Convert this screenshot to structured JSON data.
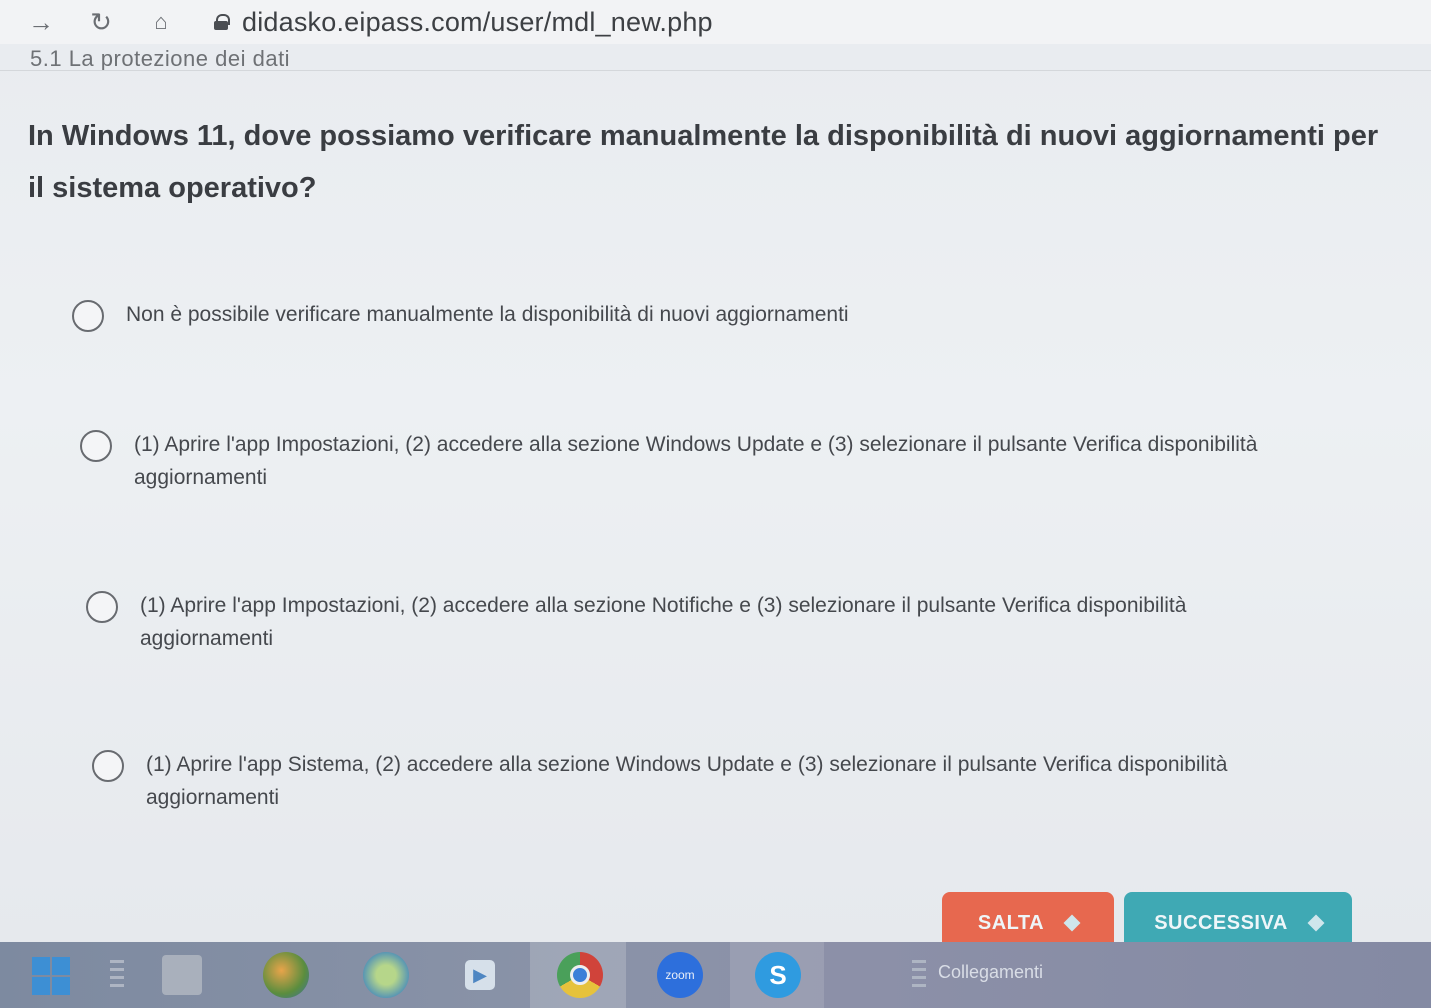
{
  "browser": {
    "url": "didasko.eipass.com/user/mdl_new.php",
    "icons": [
      "arrow-right-icon",
      "reload-icon",
      "home-icon",
      "lock-icon"
    ]
  },
  "section": {
    "title": "5.1 La protezione dei dati"
  },
  "question": {
    "text": "In Windows 11, dove possiamo verificare manualmente la disponibilità di nuovi aggiornamenti per il sistema operativo?"
  },
  "options": [
    {
      "text": "Non è possibile verificare manualmente la disponibilità di nuovi aggiornamenti"
    },
    {
      "text": "(1) Aprire l'app Impostazioni, (2) accedere alla sezione Windows Update e (3) selezionare il pulsante Verifica disponibilità aggiornamenti"
    },
    {
      "text": "(1) Aprire l'app Impostazioni, (2) accedere alla sezione Notifiche e (3) selezionare il pulsante Verifica disponibilità aggiornamenti"
    },
    {
      "text": "(1) Aprire l'app Sistema, (2) accedere alla sezione Windows Update e (3) selezionare il pulsante Verifica disponibilità aggiornamenti"
    }
  ],
  "buttons": {
    "skip_label": "SALTA",
    "next_label": "SUCCESSIVA"
  },
  "taskbar": {
    "zoom_label": "zoom",
    "links_label": "Collegamenti"
  },
  "colors": {
    "skip": "#e7684f",
    "next": "#3fa9b4"
  }
}
